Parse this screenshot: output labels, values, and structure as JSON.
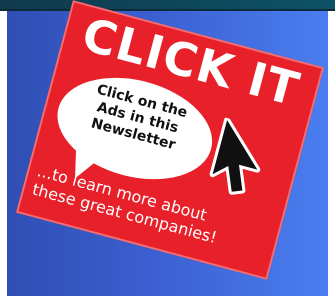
{
  "ad": {
    "headline": "CLICK IT",
    "bubble_lines": [
      "Click on the",
      "Ads in this",
      "Newsletter"
    ],
    "tagline_lines": [
      "...to learn more about",
      "these great companies!"
    ]
  },
  "colors": {
    "card": "#e8202a",
    "panel_left": "#2f4fb4",
    "panel_right": "#4a7ef0",
    "top_strip": "#0f3a4c"
  },
  "icons": {
    "cursor": "mouse-pointer-arrow-icon"
  }
}
